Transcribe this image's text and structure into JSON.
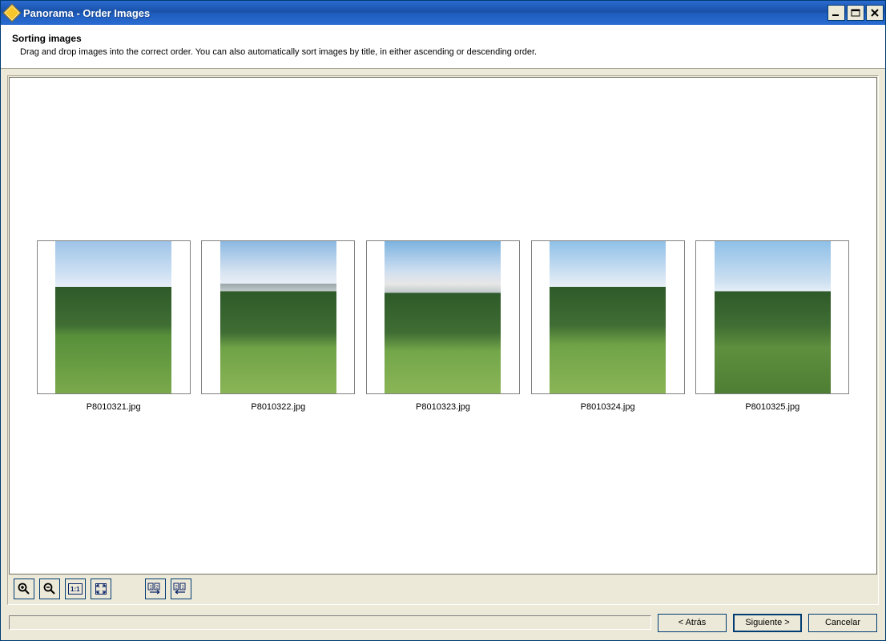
{
  "window": {
    "title": "Panorama - Order Images"
  },
  "header": {
    "heading": "Sorting images",
    "subheading": "Drag and drop images into the correct order. You can also automatically sort images by title, in either ascending or descending order."
  },
  "thumbnails": {
    "items": [
      {
        "filename": "P8010321.jpg"
      },
      {
        "filename": "P8010322.jpg"
      },
      {
        "filename": "P8010323.jpg"
      },
      {
        "filename": "P8010324.jpg"
      },
      {
        "filename": "P8010325.jpg"
      }
    ]
  },
  "toolbar": {
    "icons": {
      "zoom_in": "zoom-in-icon",
      "zoom_out": "zoom-out-icon",
      "actual_size": "actual-size-icon",
      "fit": "fit-screen-icon",
      "sort_asc": "sort-ascending-icon",
      "sort_desc": "sort-descending-icon"
    }
  },
  "wizard": {
    "back": "< Atrás",
    "next": "Siguiente >",
    "cancel": "Cancelar"
  }
}
